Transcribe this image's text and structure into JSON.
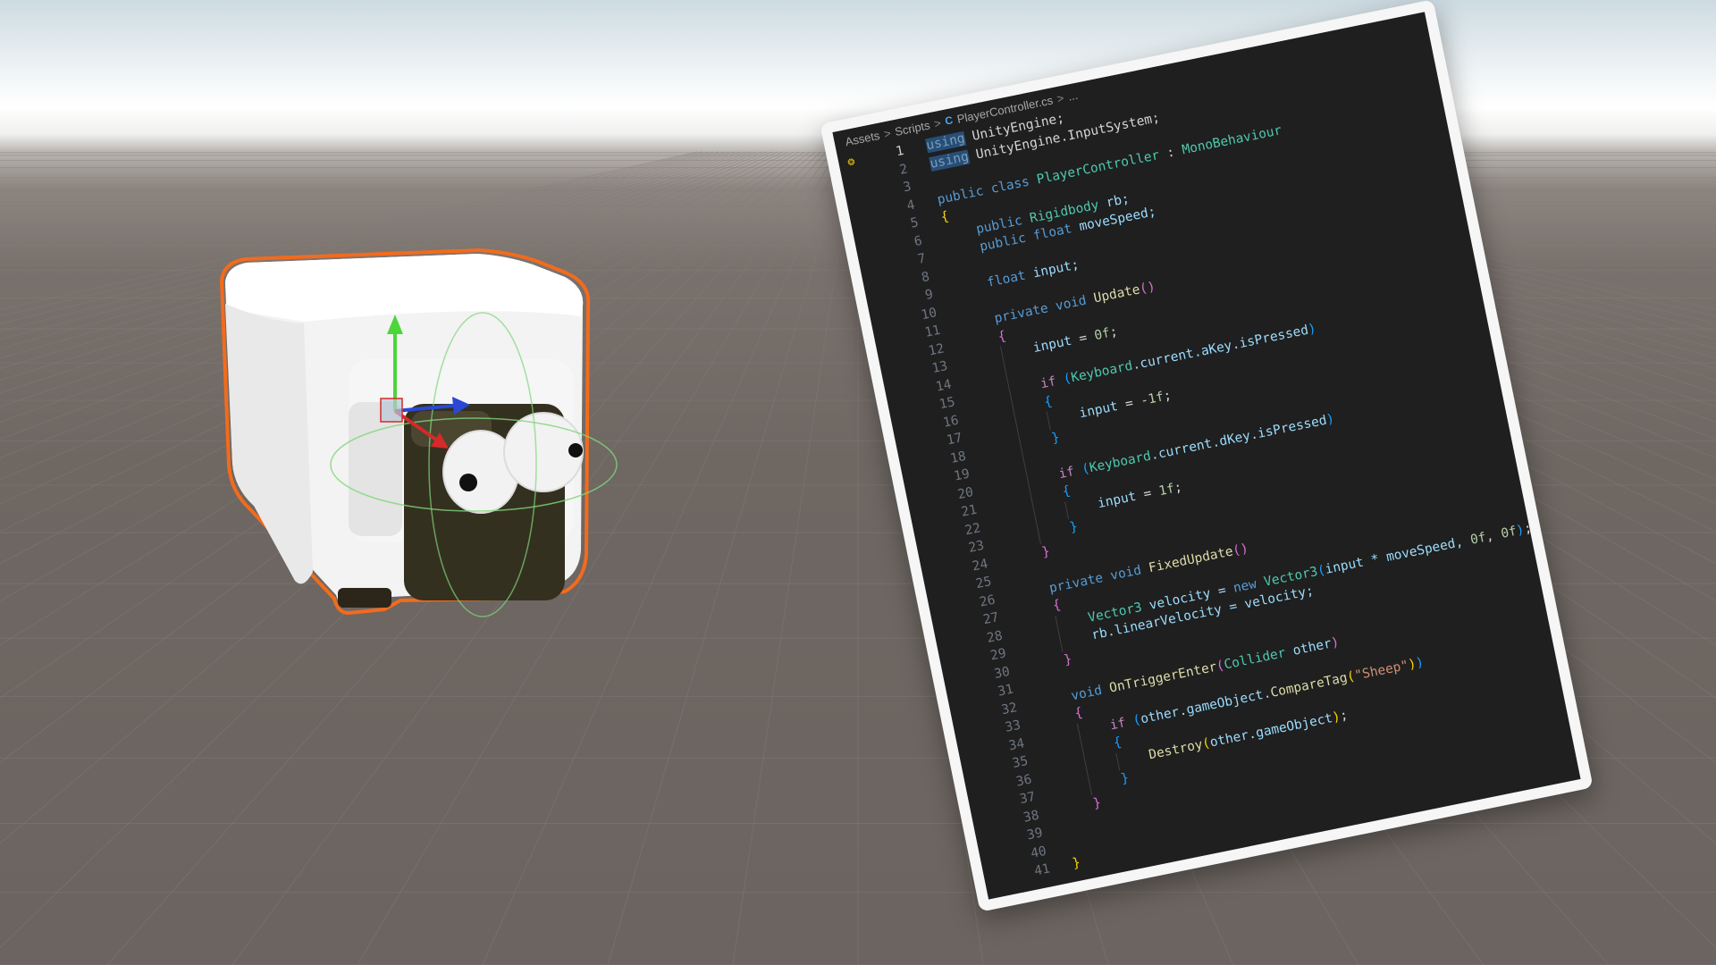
{
  "editor": {
    "breadcrumb": {
      "items": [
        "Assets",
        "Scripts",
        "PlayerController.cs",
        "..."
      ],
      "separator": ">"
    },
    "active_line": 1,
    "colors": {
      "background": "#1f1f1f",
      "keyword": "#569cd6",
      "control_keyword": "#c586c0",
      "type": "#4ec9b0",
      "function": "#dcdcaa",
      "string": "#ce9178",
      "number": "#b5cea8"
    },
    "lines": [
      {
        "n": "1",
        "indent": 0,
        "tokens": [
          {
            "t": "using",
            "c": "hl"
          },
          {
            "t": " UnityEngine;",
            "c": "pu"
          }
        ]
      },
      {
        "n": "2",
        "indent": 0,
        "tokens": [
          {
            "t": "using",
            "c": "hl"
          },
          {
            "t": " UnityEngine.InputSystem;",
            "c": "pu"
          }
        ]
      },
      {
        "n": "3",
        "indent": 0,
        "tokens": []
      },
      {
        "n": "4",
        "indent": 0,
        "tokens": [
          {
            "t": "public",
            "c": "k"
          },
          {
            "t": " ",
            "c": "pu"
          },
          {
            "t": "class",
            "c": "k"
          },
          {
            "t": " ",
            "c": "pu"
          },
          {
            "t": "PlayerController",
            "c": "ty"
          },
          {
            "t": " : ",
            "c": "pu"
          },
          {
            "t": "MonoBehaviour",
            "c": "ty"
          }
        ]
      },
      {
        "n": "5",
        "indent": 0,
        "tokens": [
          {
            "t": "{",
            "c": "b1"
          }
        ]
      },
      {
        "n": "6",
        "indent": 1,
        "tokens": [
          {
            "t": "public",
            "c": "k"
          },
          {
            "t": " ",
            "c": "pu"
          },
          {
            "t": "Rigidbody",
            "c": "ty"
          },
          {
            "t": " rb;",
            "c": "va"
          }
        ]
      },
      {
        "n": "7",
        "indent": 1,
        "tokens": [
          {
            "t": "public",
            "c": "k"
          },
          {
            "t": " ",
            "c": "pu"
          },
          {
            "t": "float",
            "c": "k"
          },
          {
            "t": " moveSpeed;",
            "c": "va"
          }
        ]
      },
      {
        "n": "8",
        "indent": 1,
        "tokens": []
      },
      {
        "n": "9",
        "indent": 1,
        "tokens": [
          {
            "t": "float",
            "c": "k"
          },
          {
            "t": " input;",
            "c": "va"
          }
        ]
      },
      {
        "n": "10",
        "indent": 1,
        "tokens": []
      },
      {
        "n": "11",
        "indent": 1,
        "tokens": [
          {
            "t": "private",
            "c": "k"
          },
          {
            "t": " ",
            "c": "pu"
          },
          {
            "t": "void",
            "c": "k"
          },
          {
            "t": " ",
            "c": "pu"
          },
          {
            "t": "Update",
            "c": "fn"
          },
          {
            "t": "()",
            "c": "b2"
          }
        ]
      },
      {
        "n": "12",
        "indent": 1,
        "tokens": [
          {
            "t": "{",
            "c": "b2"
          }
        ]
      },
      {
        "n": "13",
        "indent": 2,
        "tokens": [
          {
            "t": "input",
            "c": "va"
          },
          {
            "t": " = ",
            "c": "pu"
          },
          {
            "t": "0f",
            "c": "nu"
          },
          {
            "t": ";",
            "c": "pu"
          }
        ]
      },
      {
        "n": "14",
        "indent": 2,
        "tokens": []
      },
      {
        "n": "15",
        "indent": 2,
        "tokens": [
          {
            "t": "if",
            "c": "kc"
          },
          {
            "t": " ",
            "c": "pu"
          },
          {
            "t": "(",
            "c": "b3"
          },
          {
            "t": "Keyboard",
            "c": "ty"
          },
          {
            "t": ".current.aKey.isPressed",
            "c": "va"
          },
          {
            "t": ")",
            "c": "b3"
          }
        ]
      },
      {
        "n": "16",
        "indent": 2,
        "tokens": [
          {
            "t": "{",
            "c": "b3"
          }
        ]
      },
      {
        "n": "17",
        "indent": 3,
        "tokens": [
          {
            "t": "input",
            "c": "va"
          },
          {
            "t": " = ",
            "c": "pu"
          },
          {
            "t": "-1f",
            "c": "nu"
          },
          {
            "t": ";",
            "c": "pu"
          }
        ]
      },
      {
        "n": "18",
        "indent": 2,
        "tokens": [
          {
            "t": "}",
            "c": "b3"
          }
        ]
      },
      {
        "n": "19",
        "indent": 2,
        "tokens": []
      },
      {
        "n": "20",
        "indent": 2,
        "tokens": [
          {
            "t": "if",
            "c": "kc"
          },
          {
            "t": " ",
            "c": "pu"
          },
          {
            "t": "(",
            "c": "b3"
          },
          {
            "t": "Keyboard",
            "c": "ty"
          },
          {
            "t": ".current.dKey.isPressed",
            "c": "va"
          },
          {
            "t": ")",
            "c": "b3"
          }
        ]
      },
      {
        "n": "21",
        "indent": 2,
        "tokens": [
          {
            "t": "{",
            "c": "b3"
          }
        ]
      },
      {
        "n": "22",
        "indent": 3,
        "tokens": [
          {
            "t": "input",
            "c": "va"
          },
          {
            "t": " = ",
            "c": "pu"
          },
          {
            "t": "1f",
            "c": "nu"
          },
          {
            "t": ";",
            "c": "pu"
          }
        ]
      },
      {
        "n": "23",
        "indent": 2,
        "tokens": [
          {
            "t": "}",
            "c": "b3"
          }
        ]
      },
      {
        "n": "24",
        "indent": 1,
        "tokens": [
          {
            "t": "}",
            "c": "b2"
          }
        ]
      },
      {
        "n": "25",
        "indent": 1,
        "tokens": []
      },
      {
        "n": "26",
        "indent": 1,
        "tokens": [
          {
            "t": "private",
            "c": "k"
          },
          {
            "t": " ",
            "c": "pu"
          },
          {
            "t": "void",
            "c": "k"
          },
          {
            "t": " ",
            "c": "pu"
          },
          {
            "t": "FixedUpdate",
            "c": "fn"
          },
          {
            "t": "()",
            "c": "b2"
          }
        ]
      },
      {
        "n": "27",
        "indent": 1,
        "tokens": [
          {
            "t": "{",
            "c": "b2"
          }
        ]
      },
      {
        "n": "28",
        "indent": 2,
        "tokens": [
          {
            "t": "Vector3",
            "c": "ty"
          },
          {
            "t": " velocity = ",
            "c": "va"
          },
          {
            "t": "new",
            "c": "k"
          },
          {
            "t": " ",
            "c": "pu"
          },
          {
            "t": "Vector3",
            "c": "ty"
          },
          {
            "t": "(",
            "c": "b3"
          },
          {
            "t": "input * moveSpeed, ",
            "c": "va"
          },
          {
            "t": "0f",
            "c": "nu"
          },
          {
            "t": ", ",
            "c": "pu"
          },
          {
            "t": "0f",
            "c": "nu"
          },
          {
            "t": ")",
            "c": "b3"
          },
          {
            "t": ";",
            "c": "pu"
          }
        ]
      },
      {
        "n": "29",
        "indent": 2,
        "tokens": [
          {
            "t": "rb.linearVelocity = velocity;",
            "c": "va"
          }
        ]
      },
      {
        "n": "30",
        "indent": 1,
        "tokens": [
          {
            "t": "}",
            "c": "b2"
          }
        ]
      },
      {
        "n": "31",
        "indent": 1,
        "tokens": []
      },
      {
        "n": "32",
        "indent": 1,
        "tokens": [
          {
            "t": "void",
            "c": "k"
          },
          {
            "t": " ",
            "c": "pu"
          },
          {
            "t": "OnTriggerEnter",
            "c": "fn"
          },
          {
            "t": "(",
            "c": "b2"
          },
          {
            "t": "Collider",
            "c": "ty"
          },
          {
            "t": " other",
            "c": "va"
          },
          {
            "t": ")",
            "c": "b2"
          }
        ]
      },
      {
        "n": "33",
        "indent": 1,
        "tokens": [
          {
            "t": "{",
            "c": "b2"
          }
        ]
      },
      {
        "n": "34",
        "indent": 2,
        "tokens": [
          {
            "t": "if",
            "c": "kc"
          },
          {
            "t": " ",
            "c": "pu"
          },
          {
            "t": "(",
            "c": "b3"
          },
          {
            "t": "other.gameObject.",
            "c": "va"
          },
          {
            "t": "CompareTag",
            "c": "fn"
          },
          {
            "t": "(",
            "c": "b1"
          },
          {
            "t": "\"Sheep\"",
            "c": "st"
          },
          {
            "t": ")",
            "c": "b1"
          },
          {
            "t": ")",
            "c": "b3"
          }
        ]
      },
      {
        "n": "35",
        "indent": 2,
        "tokens": [
          {
            "t": "{",
            "c": "b3"
          }
        ]
      },
      {
        "n": "36",
        "indent": 3,
        "tokens": [
          {
            "t": "Destroy",
            "c": "fn"
          },
          {
            "t": "(",
            "c": "b1"
          },
          {
            "t": "other.gameObject",
            "c": "va"
          },
          {
            "t": ")",
            "c": "b1"
          },
          {
            "t": ";",
            "c": "pu"
          }
        ]
      },
      {
        "n": "37",
        "indent": 2,
        "tokens": [
          {
            "t": "}",
            "c": "b3"
          }
        ]
      },
      {
        "n": "38",
        "indent": 1,
        "tokens": [
          {
            "t": "}",
            "c": "b2"
          }
        ]
      },
      {
        "n": "39",
        "indent": 1,
        "tokens": []
      },
      {
        "n": "40",
        "indent": 0,
        "tokens": []
      },
      {
        "n": "41",
        "indent": 0,
        "tokens": [
          {
            "t": "}",
            "c": "b1"
          }
        ]
      }
    ]
  },
  "scene": {
    "sky_color": "#ffffff",
    "ground_color": "#6e6762",
    "selection_outline_color": "#f26b1d",
    "gizmo_colors": {
      "y": "#4cd63a",
      "x": "#d42a2a",
      "z": "#2a48d4"
    }
  }
}
